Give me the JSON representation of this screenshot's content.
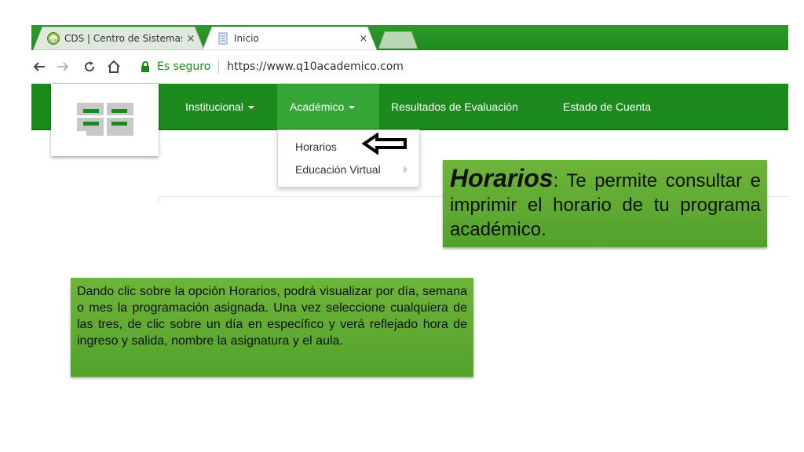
{
  "browser": {
    "tabs": [
      {
        "title": "CDS | Centro de Sistemas",
        "close": "×",
        "icon": "cds-favicon-icon"
      },
      {
        "title": "Inicio",
        "close": "×",
        "icon": "page-favicon-icon"
      }
    ],
    "secure_label": "Es seguro",
    "url": "https://www.q10academico.com",
    "accent": "#1d8a1d"
  },
  "nav": {
    "items": [
      {
        "label": "Institucional",
        "has_caret": true
      },
      {
        "label": "Académico",
        "has_caret": true,
        "active": true
      },
      {
        "label": "Resultados de Evaluación"
      },
      {
        "label": "Estado de Cuenta"
      }
    ]
  },
  "dropdown": {
    "items": [
      {
        "label": "Horarios"
      },
      {
        "label": "Educación Virtual",
        "has_submenu": true
      }
    ]
  },
  "callout_right": {
    "heading": "Horarios",
    "text": ": Te permite consultar e imprimir  el horario de tu programa académico."
  },
  "callout_left": {
    "text": "Dando clic sobre la opción Horarios, podrá visualizar por día, semana o mes  la programación asignada. Una vez seleccione cualquiera de las tres, de clic sobre un día en específico y verá reflejado hora de ingreso y salida, nombre la asignatura y el aula."
  }
}
